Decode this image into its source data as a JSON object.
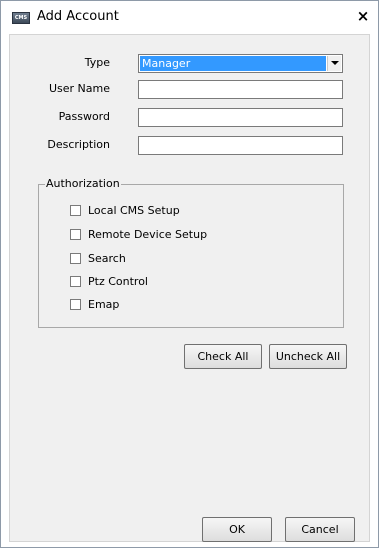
{
  "window": {
    "title": "Add Account",
    "icon_text": "CMS",
    "close_glyph": "×"
  },
  "form": {
    "type_label": "Type",
    "type_value": "Manager",
    "username_label": "User Name",
    "username_value": "",
    "password_label": "Password",
    "password_value": "",
    "description_label": "Description",
    "description_value": ""
  },
  "authorization": {
    "title": "Authorization",
    "items": [
      {
        "label": "Local CMS Setup",
        "checked": false
      },
      {
        "label": "Remote Device Setup",
        "checked": false
      },
      {
        "label": "Search",
        "checked": false
      },
      {
        "label": "Ptz Control",
        "checked": false
      },
      {
        "label": "Emap",
        "checked": false
      }
    ]
  },
  "buttons": {
    "check_all": "Check All",
    "uncheck_all": "Uncheck All",
    "ok": "OK",
    "cancel": "Cancel"
  }
}
